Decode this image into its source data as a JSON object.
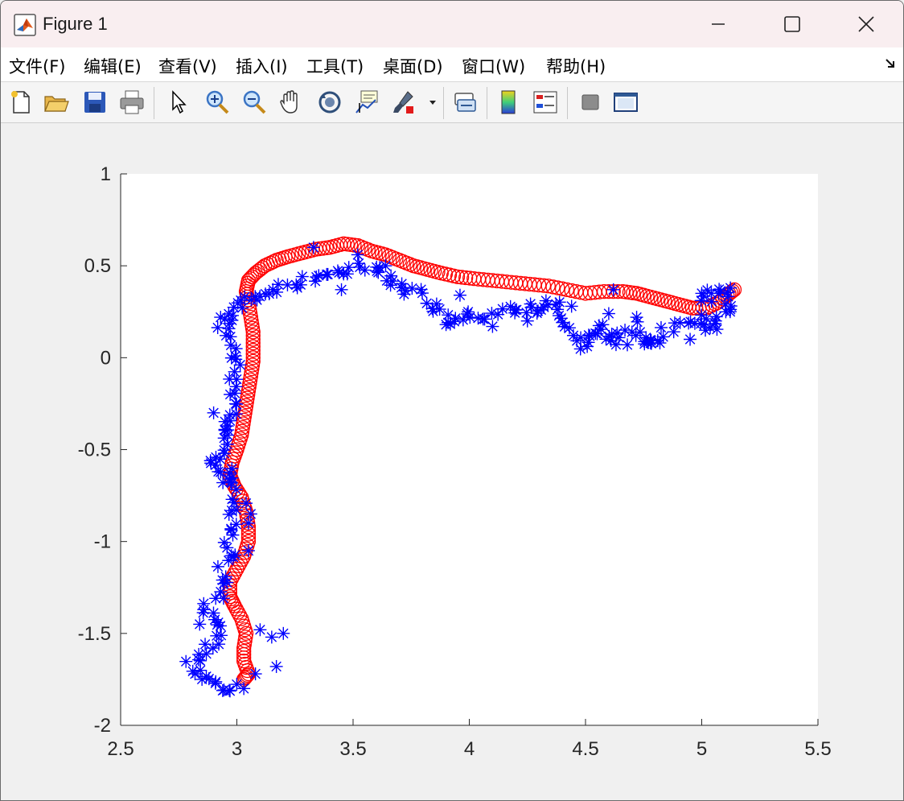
{
  "window": {
    "title": "Figure 1",
    "controls": {
      "minimize": "—",
      "maximize": "☐",
      "close": "✕"
    }
  },
  "menubar": {
    "items": [
      {
        "label": "文件(F)"
      },
      {
        "label": "编辑(E)"
      },
      {
        "label": "查看(V)"
      },
      {
        "label": "插入(I)"
      },
      {
        "label": "工具(T)"
      },
      {
        "label": "桌面(D)"
      },
      {
        "label": "窗口(W)"
      },
      {
        "label": "帮助(H)"
      }
    ],
    "corner_icon": "dock-arrow-icon"
  },
  "toolbar": {
    "buttons": [
      {
        "icon": "new-figure-icon"
      },
      {
        "icon": "open-file-icon"
      },
      {
        "icon": "save-icon"
      },
      {
        "icon": "print-icon"
      },
      {
        "icon": "select-arrow-icon"
      },
      {
        "icon": "zoom-in-icon"
      },
      {
        "icon": "zoom-out-icon"
      },
      {
        "icon": "pan-hand-icon"
      },
      {
        "icon": "rotate-3d-icon"
      },
      {
        "icon": "data-cursor-icon"
      },
      {
        "icon": "brush-icon"
      },
      {
        "icon": "link-plot-icon"
      },
      {
        "icon": "colorbar-icon"
      },
      {
        "icon": "legend-icon"
      },
      {
        "icon": "hide-plot-tools-icon"
      },
      {
        "icon": "show-plot-tools-icon"
      }
    ]
  },
  "colors": {
    "series_red": "#ff0000",
    "series_blue": "#0000ff",
    "axes_bg": "#ffffff",
    "figure_bg": "#f0f0f0"
  },
  "chart_data": {
    "type": "scatter",
    "xlim": [
      2.5,
      5.5
    ],
    "ylim": [
      -2,
      1
    ],
    "xticks": [
      2.5,
      3,
      3.5,
      4,
      4.5,
      5,
      5.5
    ],
    "yticks": [
      -2,
      -1.5,
      -1,
      -0.5,
      0,
      0.5,
      1
    ],
    "xtick_labels": [
      "2.5",
      "3",
      "3.5",
      "4",
      "4.5",
      "5",
      "5.5"
    ],
    "ytick_labels": [
      "-2",
      "-1.5",
      "-1",
      "-0.5",
      "0",
      "0.5",
      "1"
    ],
    "grid": false,
    "series": [
      {
        "marker": "circle",
        "color": "#ff0000",
        "path": [
          [
            3.03,
            -1.75
          ],
          [
            3.05,
            -1.72
          ],
          [
            3.03,
            -1.65
          ],
          [
            3.03,
            -1.58
          ],
          [
            3.04,
            -1.5
          ],
          [
            3.02,
            -1.42
          ],
          [
            2.99,
            -1.35
          ],
          [
            2.97,
            -1.3
          ],
          [
            2.97,
            -1.22
          ],
          [
            3.0,
            -1.15
          ],
          [
            3.03,
            -1.08
          ],
          [
            3.05,
            -1.0
          ],
          [
            3.05,
            -0.92
          ],
          [
            3.04,
            -0.84
          ],
          [
            3.02,
            -0.76
          ],
          [
            2.99,
            -0.7
          ],
          [
            2.97,
            -0.64
          ],
          [
            2.98,
            -0.57
          ],
          [
            3.0,
            -0.5
          ],
          [
            3.02,
            -0.42
          ],
          [
            3.03,
            -0.34
          ],
          [
            3.04,
            -0.26
          ],
          [
            3.05,
            -0.18
          ],
          [
            3.06,
            -0.1
          ],
          [
            3.07,
            -0.02
          ],
          [
            3.07,
            0.06
          ],
          [
            3.07,
            0.14
          ],
          [
            3.06,
            0.22
          ],
          [
            3.05,
            0.3
          ],
          [
            3.04,
            0.36
          ],
          [
            3.05,
            0.42
          ],
          [
            3.08,
            0.46
          ],
          [
            3.12,
            0.5
          ],
          [
            3.17,
            0.53
          ],
          [
            3.22,
            0.55
          ],
          [
            3.28,
            0.57
          ],
          [
            3.34,
            0.59
          ],
          [
            3.4,
            0.6
          ],
          [
            3.46,
            0.62
          ],
          [
            3.52,
            0.61
          ],
          [
            3.58,
            0.58
          ],
          [
            3.64,
            0.56
          ],
          [
            3.7,
            0.53
          ],
          [
            3.76,
            0.5
          ],
          [
            3.82,
            0.48
          ],
          [
            3.88,
            0.46
          ],
          [
            3.95,
            0.44
          ],
          [
            4.02,
            0.43
          ],
          [
            4.1,
            0.42
          ],
          [
            4.18,
            0.41
          ],
          [
            4.26,
            0.4
          ],
          [
            4.34,
            0.39
          ],
          [
            4.42,
            0.37
          ],
          [
            4.5,
            0.35
          ],
          [
            4.58,
            0.36
          ],
          [
            4.66,
            0.36
          ],
          [
            4.72,
            0.35
          ],
          [
            4.78,
            0.33
          ],
          [
            4.84,
            0.31
          ],
          [
            4.9,
            0.29
          ],
          [
            4.96,
            0.27
          ],
          [
            5.02,
            0.27
          ],
          [
            5.07,
            0.3
          ],
          [
            5.11,
            0.34
          ],
          [
            5.14,
            0.37
          ]
        ]
      },
      {
        "marker": "asterisk",
        "color": "#0000ff",
        "path": [
          [
            3.0,
            -1.78
          ],
          [
            2.96,
            -1.83
          ],
          [
            2.9,
            -1.75
          ],
          [
            2.84,
            -1.7
          ],
          [
            2.8,
            -1.65
          ],
          [
            2.86,
            -1.6
          ],
          [
            2.92,
            -1.55
          ],
          [
            2.95,
            -1.48
          ],
          [
            2.9,
            -1.42
          ],
          [
            2.86,
            -1.35
          ],
          [
            2.92,
            -1.3
          ],
          [
            2.96,
            -1.22
          ],
          [
            2.93,
            -1.15
          ],
          [
            2.98,
            -1.08
          ],
          [
            2.96,
            -1.0
          ],
          [
            3.0,
            -0.93
          ],
          [
            2.98,
            -0.85
          ],
          [
            3.02,
            -0.78
          ],
          [
            2.97,
            -0.7
          ],
          [
            3.0,
            -0.63
          ],
          [
            2.93,
            -0.6
          ],
          [
            2.9,
            -0.55
          ],
          [
            2.94,
            -0.5
          ],
          [
            2.97,
            -0.45
          ],
          [
            2.95,
            -0.4
          ],
          [
            2.98,
            -0.35
          ],
          [
            3.0,
            -0.3
          ],
          [
            2.99,
            -0.22
          ],
          [
            2.97,
            -0.14
          ],
          [
            3.0,
            -0.06
          ],
          [
            2.98,
            0.02
          ],
          [
            2.96,
            0.1
          ],
          [
            2.94,
            0.17
          ],
          [
            2.97,
            0.22
          ],
          [
            3.0,
            0.27
          ],
          [
            3.03,
            0.3
          ],
          [
            3.07,
            0.33
          ],
          [
            3.12,
            0.35
          ],
          [
            3.18,
            0.38
          ],
          [
            3.24,
            0.4
          ],
          [
            3.3,
            0.43
          ],
          [
            3.36,
            0.46
          ],
          [
            3.42,
            0.44
          ],
          [
            3.48,
            0.47
          ],
          [
            3.54,
            0.5
          ],
          [
            3.6,
            0.48
          ],
          [
            3.64,
            0.44
          ],
          [
            3.68,
            0.4
          ],
          [
            3.72,
            0.37
          ],
          [
            3.78,
            0.35
          ],
          [
            3.84,
            0.3
          ],
          [
            3.88,
            0.24
          ],
          [
            3.92,
            0.2
          ],
          [
            3.97,
            0.22
          ],
          [
            4.02,
            0.25
          ],
          [
            4.08,
            0.22
          ],
          [
            4.14,
            0.26
          ],
          [
            4.2,
            0.24
          ],
          [
            4.26,
            0.28
          ],
          [
            4.3,
            0.25
          ],
          [
            4.36,
            0.3
          ],
          [
            4.4,
            0.27
          ],
          [
            4.42,
            0.2
          ],
          [
            4.45,
            0.12
          ],
          [
            4.48,
            0.06
          ],
          [
            4.52,
            0.1
          ],
          [
            4.56,
            0.17
          ],
          [
            4.6,
            0.15
          ],
          [
            4.62,
            0.08
          ],
          [
            4.66,
            0.12
          ],
          [
            4.7,
            0.18
          ],
          [
            4.74,
            0.1
          ],
          [
            4.77,
            0.06
          ],
          [
            4.8,
            0.1
          ],
          [
            4.85,
            0.14
          ],
          [
            4.92,
            0.18
          ],
          [
            4.97,
            0.22
          ],
          [
            5.02,
            0.2
          ],
          [
            5.05,
            0.16
          ],
          [
            5.08,
            0.2
          ],
          [
            5.1,
            0.26
          ],
          [
            5.12,
            0.3
          ],
          [
            5.1,
            0.36
          ],
          [
            5.06,
            0.38
          ],
          [
            5.02,
            0.33
          ],
          [
            4.98,
            0.3
          ]
        ],
        "outliers": [
          [
            2.9,
            -0.3
          ],
          [
            3.2,
            -1.5
          ],
          [
            3.15,
            -1.52
          ],
          [
            3.17,
            -1.68
          ],
          [
            3.1,
            -1.48
          ],
          [
            3.08,
            -1.72
          ],
          [
            3.03,
            -1.8
          ],
          [
            2.84,
            -1.45
          ],
          [
            2.82,
            -1.72
          ],
          [
            2.85,
            -1.75
          ],
          [
            4.82,
            0.08
          ],
          [
            4.95,
            0.1
          ],
          [
            5.0,
            0.35
          ],
          [
            4.62,
            0.37
          ],
          [
            3.33,
            0.6
          ],
          [
            3.45,
            0.37
          ],
          [
            3.64,
            0.5
          ],
          [
            3.52,
            0.56
          ],
          [
            3.9,
            0.18
          ],
          [
            3.96,
            0.34
          ],
          [
            4.1,
            0.17
          ],
          [
            4.25,
            0.2
          ],
          [
            4.33,
            0.31
          ],
          [
            4.44,
            0.28
          ],
          [
            4.55,
            0.13
          ],
          [
            4.72,
            0.22
          ],
          [
            4.78,
            0.08
          ],
          [
            4.6,
            0.24
          ],
          [
            4.68,
            0.07
          ],
          [
            2.93,
            0.22
          ],
          [
            2.94,
            -0.68
          ],
          [
            2.92,
            -0.62
          ],
          [
            3.05,
            -0.9
          ],
          [
            3.06,
            -0.85
          ],
          [
            3.05,
            -1.05
          ]
        ]
      }
    ]
  }
}
